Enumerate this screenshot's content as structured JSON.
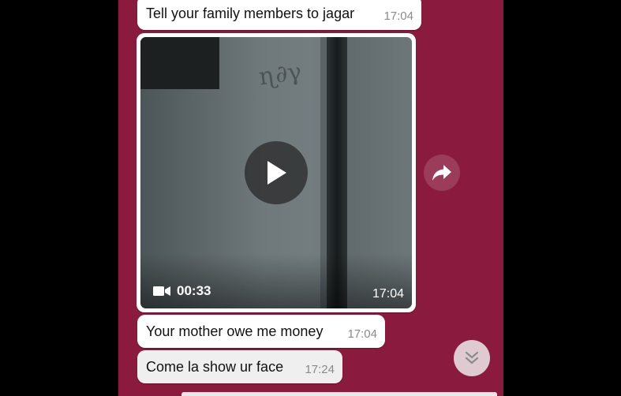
{
  "messages": [
    {
      "text": "Tell your family members to jagar",
      "time": "17:04"
    },
    {
      "type": "video",
      "duration": "00:33",
      "time": "17:04"
    },
    {
      "text": "Your mother owe me money",
      "time": "17:04"
    },
    {
      "text": "Come la show ur face",
      "time": "17:24"
    }
  ],
  "icons": {
    "play": "play-icon",
    "video_camera": "video-camera-icon",
    "share": "share-arrow-icon",
    "scroll_down": "double-chevron-down-icon"
  },
  "colors": {
    "chat_background": "#8a1a3e",
    "bubble": "#ffffff",
    "time_text": "#8a8a8a"
  }
}
